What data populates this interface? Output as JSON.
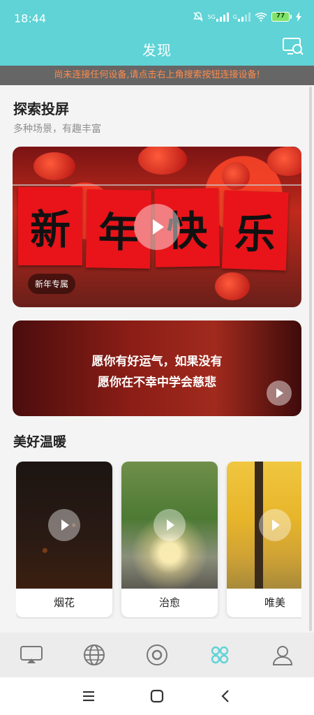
{
  "status": {
    "time": "18:44",
    "net1": "5G",
    "net2": "G",
    "battery": "77"
  },
  "header": {
    "title": "发现"
  },
  "notice": "尚未连接任何设备,请点击右上角搜索按钮连接设备!",
  "explore": {
    "title": "探索投屏",
    "subtitle": "多种场景，有趣丰富",
    "banner1": {
      "chars": [
        "新",
        "年",
        "快",
        "乐"
      ],
      "tag": "新年专属"
    },
    "banner2": {
      "line1": "愿你有好运气，如果没有",
      "line2": "愿你在不幸中学会慈悲"
    }
  },
  "warm": {
    "title": "美好温暖",
    "cards": [
      {
        "label": "烟花"
      },
      {
        "label": "治愈"
      },
      {
        "label": "唯美"
      }
    ]
  },
  "tabbar": [
    "cast-tab-icon",
    "globe-tab-icon",
    "target-tab-icon",
    "discover-tab-icon",
    "user-tab-icon"
  ],
  "colors": {
    "primary": "#5fd3d6",
    "noticeText": "#ff8a4b",
    "noticeBg": "#666666"
  }
}
